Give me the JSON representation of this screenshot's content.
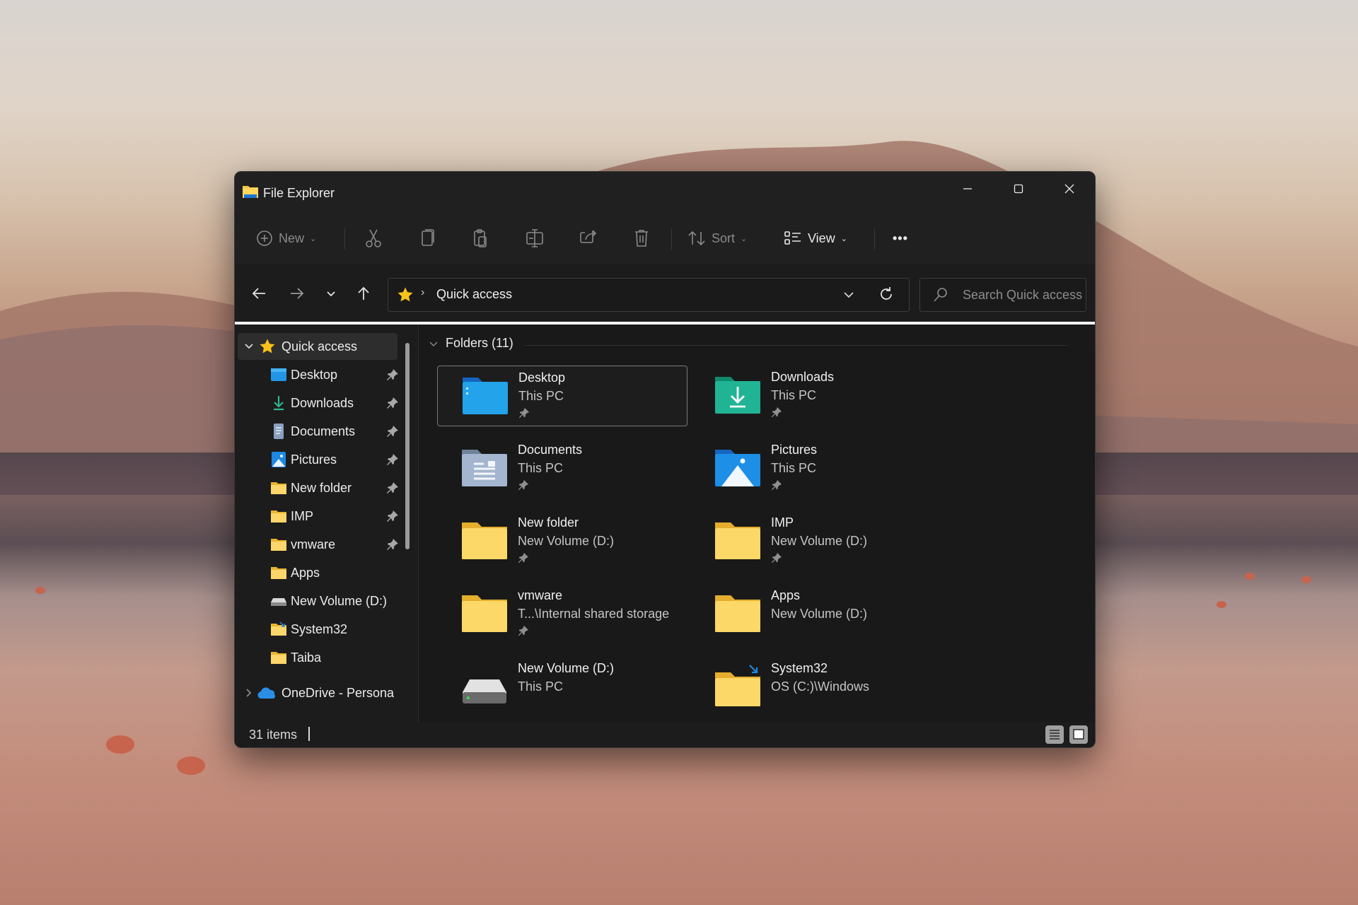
{
  "window": {
    "title": "File Explorer",
    "controls": {
      "minimize": "minimize-icon",
      "maximize": "maximize-icon",
      "close": "close-icon"
    }
  },
  "toolbar": {
    "new_label": "New",
    "sort_label": "Sort",
    "view_label": "View",
    "more_label": "•••",
    "icons": [
      "new-icon",
      "cut-icon",
      "copy-icon",
      "paste-icon",
      "rename-icon",
      "share-icon",
      "delete-icon",
      "sort-icon",
      "view-icon",
      "more-icon"
    ]
  },
  "address": {
    "location_icon": "star-icon",
    "path": "Quick access",
    "search_placeholder": "Search Quick access"
  },
  "nav": {
    "root": {
      "label": "Quick access",
      "expanded": true
    },
    "items": [
      {
        "label": "Desktop",
        "icon": "desktop-folder-icon",
        "pinned": true
      },
      {
        "label": "Downloads",
        "icon": "download-icon",
        "pinned": true
      },
      {
        "label": "Documents",
        "icon": "documents-icon",
        "pinned": true
      },
      {
        "label": "Pictures",
        "icon": "pictures-icon",
        "pinned": true
      },
      {
        "label": "New folder",
        "icon": "folder-icon",
        "pinned": true
      },
      {
        "label": "IMP",
        "icon": "folder-icon",
        "pinned": true
      },
      {
        "label": "vmware",
        "icon": "folder-icon",
        "pinned": true
      },
      {
        "label": "Apps",
        "icon": "folder-icon",
        "pinned": false
      },
      {
        "label": "New Volume (D:)",
        "icon": "drive-icon",
        "pinned": false
      },
      {
        "label": "System32",
        "icon": "shortcut-folder-icon",
        "pinned": false
      },
      {
        "label": "Taiba",
        "icon": "folder-icon",
        "pinned": false
      }
    ],
    "onedrive": {
      "label": "OneDrive - Persona",
      "expanded": false
    }
  },
  "content": {
    "group_label": "Folders (11)",
    "folders": [
      {
        "name": "Desktop",
        "location": "This PC",
        "pinned": true,
        "icon": "desktop-folder-icon",
        "selected": true
      },
      {
        "name": "Downloads",
        "location": "This PC",
        "pinned": true,
        "icon": "downloads-folder-icon",
        "selected": false
      },
      {
        "name": "Documents",
        "location": "This PC",
        "pinned": true,
        "icon": "documents-folder-icon",
        "selected": false
      },
      {
        "name": "Pictures",
        "location": "This PC",
        "pinned": true,
        "icon": "pictures-folder-icon",
        "selected": false
      },
      {
        "name": "New folder",
        "location": "New Volume (D:)",
        "pinned": true,
        "icon": "folder-icon",
        "selected": false
      },
      {
        "name": "IMP",
        "location": "New Volume (D:)",
        "pinned": true,
        "icon": "folder-icon",
        "selected": false
      },
      {
        "name": "vmware",
        "location": "T...\\Internal shared storage",
        "pinned": true,
        "icon": "folder-icon",
        "selected": false
      },
      {
        "name": "Apps",
        "location": "New Volume (D:)",
        "pinned": false,
        "icon": "folder-icon",
        "selected": false
      },
      {
        "name": "New Volume (D:)",
        "location": "This PC",
        "pinned": false,
        "icon": "drive-icon",
        "selected": false
      },
      {
        "name": "System32",
        "location": "OS (C:)\\Windows",
        "pinned": false,
        "icon": "shortcut-folder-icon",
        "selected": false
      }
    ]
  },
  "status": {
    "item_count": "31 items",
    "view_modes": [
      "details-view",
      "large-icons-view"
    ],
    "active_view": "large-icons-view"
  },
  "colors": {
    "window_bg": "#1c1c1c",
    "folder_yellow": "#f4c542",
    "desktop_blue": "#1e8fe0",
    "downloads_teal": "#1fae8f",
    "star_yellow": "#f8c21c"
  }
}
